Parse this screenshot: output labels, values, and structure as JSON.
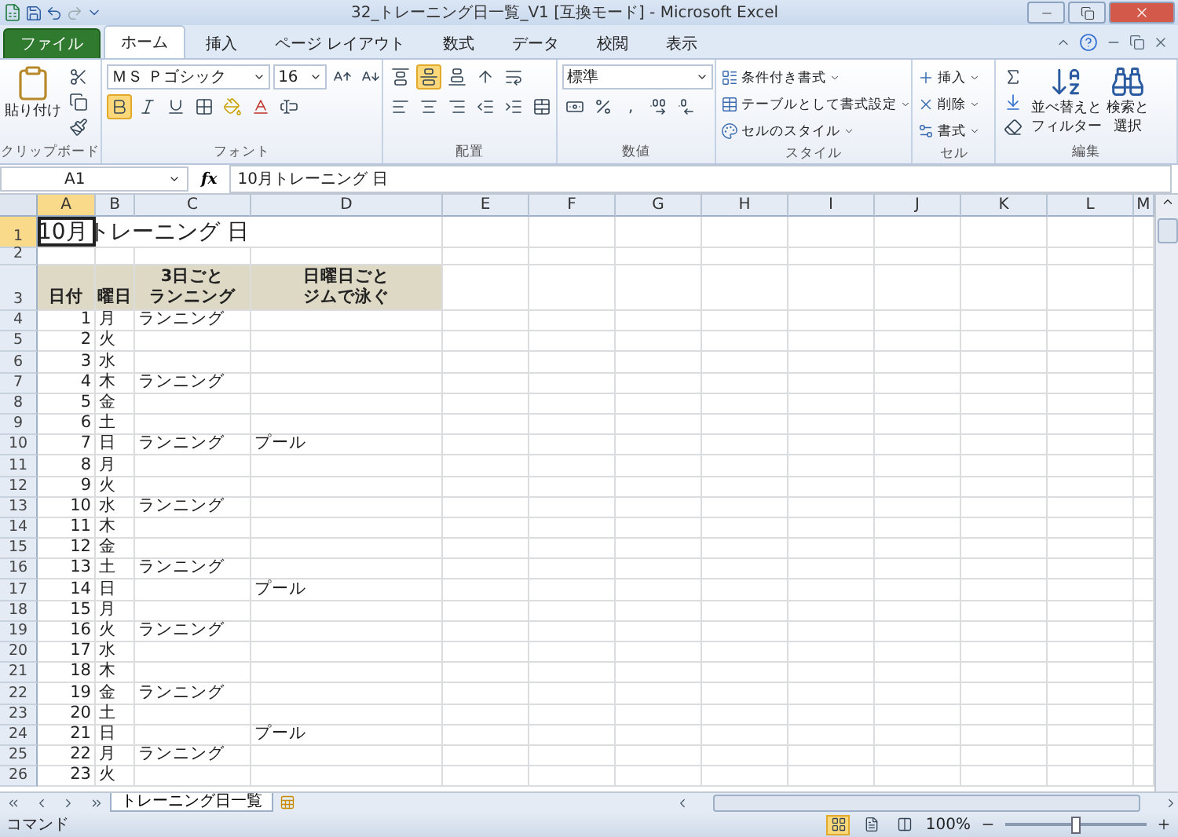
{
  "window": {
    "title": "32_トレーニング日一覧_V1  [互換モード] - Microsoft Excel"
  },
  "ribbon_tabs": [
    {
      "label": "ファイル",
      "kind": "file",
      "selected": false
    },
    {
      "label": "ホーム",
      "kind": "tab",
      "selected": true
    },
    {
      "label": "挿入",
      "kind": "tab",
      "selected": false
    },
    {
      "label": "ページ レイアウト",
      "kind": "tab",
      "selected": false
    },
    {
      "label": "数式",
      "kind": "tab",
      "selected": false
    },
    {
      "label": "データ",
      "kind": "tab",
      "selected": false
    },
    {
      "label": "校閲",
      "kind": "tab",
      "selected": false
    },
    {
      "label": "表示",
      "kind": "tab",
      "selected": false
    }
  ],
  "ribbon": {
    "clipboard": {
      "label": "クリップボード",
      "paste": "貼り付け"
    },
    "font": {
      "label": "フォント",
      "font_name": "ＭＳ Ｐゴシック",
      "font_size": "16",
      "bold": true,
      "italic": false,
      "underline": false
    },
    "alignment": {
      "label": "配置",
      "vertical": [
        {
          "selected": false
        },
        {
          "selected": true
        },
        {
          "selected": false
        }
      ]
    },
    "number": {
      "label": "数値",
      "format": "標準",
      "comma": ","
    },
    "styles": {
      "label": "スタイル",
      "items": [
        "条件付き書式",
        "テーブルとして書式設定",
        "セルのスタイル"
      ]
    },
    "cells": {
      "label": "セル",
      "items": [
        "挿入",
        "削除",
        "書式"
      ]
    },
    "editing": {
      "label": "編集",
      "sort": [
        "並べ替えと",
        "フィルター"
      ],
      "find": [
        "検索と",
        "選択"
      ]
    }
  },
  "formula_bar": {
    "name_box": "A1",
    "function_label": "fx",
    "formula": "10月トレーニング 日"
  },
  "columns": [
    {
      "label": "A",
      "selected": true
    },
    {
      "label": "B",
      "selected": false
    },
    {
      "label": "C",
      "selected": false
    },
    {
      "label": "D",
      "selected": false
    },
    {
      "label": "E",
      "selected": false
    },
    {
      "label": "F",
      "selected": false
    },
    {
      "label": "G",
      "selected": false
    },
    {
      "label": "H",
      "selected": false
    },
    {
      "label": "I",
      "selected": false
    },
    {
      "label": "J",
      "selected": false
    },
    {
      "label": "K",
      "selected": false
    },
    {
      "label": "L",
      "selected": false
    },
    {
      "label": "M",
      "selected": false
    }
  ],
  "sheet": {
    "title_row": {
      "number": "1",
      "selected": true,
      "text": "10月トレーニング 日"
    },
    "blank_row": {
      "number": "2",
      "selected": false
    },
    "header_row": {
      "number": "3",
      "selected": false,
      "cells": [
        [
          "日付"
        ],
        [
          "曜日"
        ],
        [
          "3日ごと",
          "ランニング"
        ],
        [
          "日曜日ごと",
          "ジムで泳ぐ"
        ]
      ]
    },
    "rows": [
      {
        "number": "4",
        "selected": false,
        "date": "1",
        "day": "月",
        "running": "ランニング"
      },
      {
        "number": "5",
        "selected": false,
        "date": "2",
        "day": "火"
      },
      {
        "number": "6",
        "selected": false,
        "date": "3",
        "day": "水"
      },
      {
        "number": "7",
        "selected": false,
        "date": "4",
        "day": "木",
        "running": "ランニング"
      },
      {
        "number": "8",
        "selected": false,
        "date": "5",
        "day": "金"
      },
      {
        "number": "9",
        "selected": false,
        "date": "6",
        "day": "土"
      },
      {
        "number": "10",
        "selected": false,
        "date": "7",
        "day": "日",
        "running": "ランニング",
        "swimming": "プール"
      },
      {
        "number": "11",
        "selected": false,
        "date": "8",
        "day": "月"
      },
      {
        "number": "12",
        "selected": false,
        "date": "9",
        "day": "火"
      },
      {
        "number": "13",
        "selected": false,
        "date": "10",
        "day": "水",
        "running": "ランニング"
      },
      {
        "number": "14",
        "selected": false,
        "date": "11",
        "day": "木"
      },
      {
        "number": "15",
        "selected": false,
        "date": "12",
        "day": "金"
      },
      {
        "number": "16",
        "selected": false,
        "date": "13",
        "day": "土",
        "running": "ランニング"
      },
      {
        "number": "17",
        "selected": false,
        "date": "14",
        "day": "日",
        "swimming": "プール"
      },
      {
        "number": "18",
        "selected": false,
        "date": "15",
        "day": "月"
      },
      {
        "number": "19",
        "selected": false,
        "date": "16",
        "day": "火",
        "running": "ランニング"
      },
      {
        "number": "20",
        "selected": false,
        "date": "17",
        "day": "水"
      },
      {
        "number": "21",
        "selected": false,
        "date": "18",
        "day": "木"
      },
      {
        "number": "22",
        "selected": false,
        "date": "19",
        "day": "金",
        "running": "ランニング"
      },
      {
        "number": "23",
        "selected": false,
        "date": "20",
        "day": "土"
      },
      {
        "number": "24",
        "selected": false,
        "date": "21",
        "day": "日",
        "swimming": "プール"
      },
      {
        "number": "25",
        "selected": false,
        "date": "22",
        "day": "月",
        "running": "ランニング"
      },
      {
        "number": "26",
        "selected": false,
        "date": "23",
        "day": "火"
      }
    ]
  },
  "sheet_tabs": [
    {
      "label": "トレーニング日一覧",
      "selected": true
    }
  ],
  "status_bar": {
    "mode": "コマンド",
    "zoom": "100%",
    "zoom_slider": {
      "level": 0.5
    }
  }
}
